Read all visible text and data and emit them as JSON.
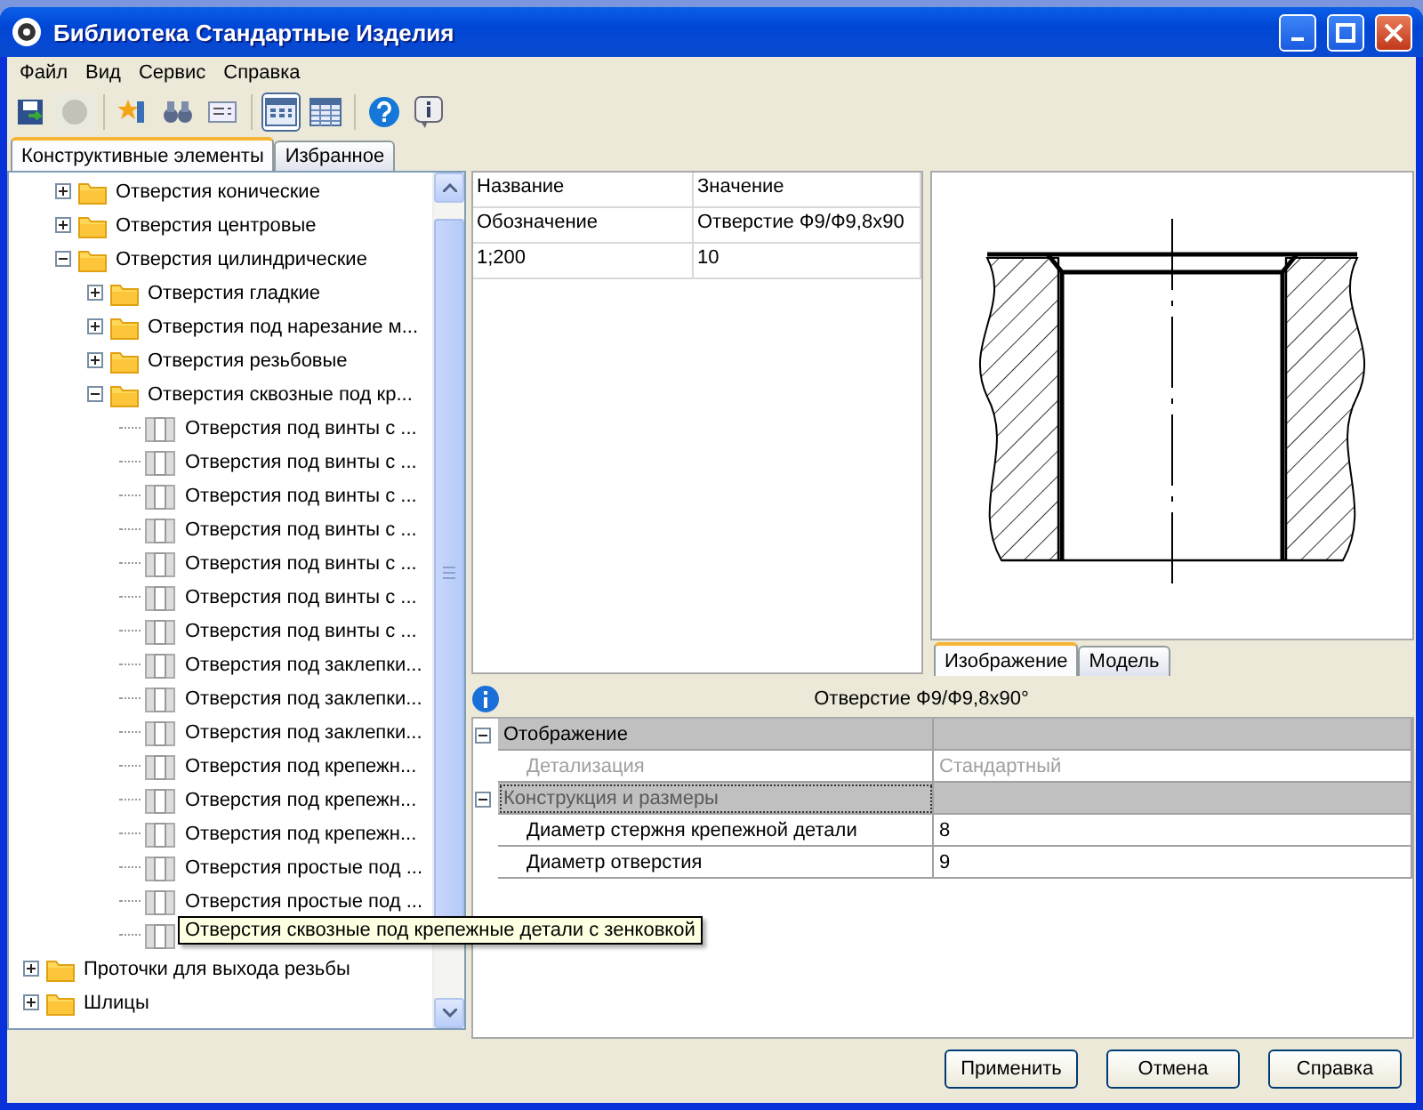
{
  "window": {
    "title": "Библиотека Стандартные Изделия"
  },
  "menu": [
    "Файл",
    "Вид",
    "Сервис",
    "Справка"
  ],
  "toolbar_groups": [
    [
      {
        "kind": "save",
        "disabled": false,
        "pressed": false
      },
      {
        "kind": "stop",
        "disabled": true,
        "pressed": false
      }
    ],
    [
      {
        "kind": "favorite",
        "disabled": false,
        "pressed": false
      },
      {
        "kind": "find",
        "disabled": false,
        "pressed": false
      },
      {
        "kind": "card",
        "disabled": false,
        "pressed": false
      }
    ],
    [
      {
        "kind": "grid",
        "disabled": false,
        "pressed": true
      },
      {
        "kind": "table",
        "disabled": false,
        "pressed": false
      }
    ],
    [
      {
        "kind": "help",
        "disabled": false,
        "pressed": false
      },
      {
        "kind": "info",
        "disabled": false,
        "pressed": false
      }
    ]
  ],
  "left_tabs": [
    {
      "label": "Конструктивные элементы",
      "selected": true
    },
    {
      "label": "Избранное",
      "selected": false
    }
  ],
  "tree": {
    "continued_children": [
      {
        "label": "Отверстия конические",
        "kind": "folder",
        "expanded": false
      },
      {
        "label": "Отверстия центровые",
        "kind": "folder",
        "expanded": false
      },
      {
        "label": "Отверстия цилиндрические",
        "kind": "folder",
        "expanded": true,
        "children": [
          {
            "label": "Отверстия гладкие",
            "kind": "folder",
            "expanded": false
          },
          {
            "label": "Отверстия под нарезание м...",
            "kind": "folder",
            "expanded": false
          },
          {
            "label": "Отверстия резьбовые",
            "kind": "folder",
            "expanded": false
          },
          {
            "label": "Отверстия сквозные под кр...",
            "kind": "folder",
            "expanded": true,
            "children": [
              {
                "label": "Отверстия под винты с ...",
                "kind": "part"
              },
              {
                "label": "Отверстия под винты с ...",
                "kind": "part"
              },
              {
                "label": "Отверстия под винты с ...",
                "kind": "part"
              },
              {
                "label": "Отверстия под винты с ...",
                "kind": "part"
              },
              {
                "label": "Отверстия под винты с ...",
                "kind": "part"
              },
              {
                "label": "Отверстия под винты с ...",
                "kind": "part"
              },
              {
                "label": "Отверстия под винты с ...",
                "kind": "part"
              },
              {
                "label": "Отверстия под заклепки...",
                "kind": "part"
              },
              {
                "label": "Отверстия под заклепки...",
                "kind": "part"
              },
              {
                "label": "Отверстия под заклепки...",
                "kind": "part"
              },
              {
                "label": "Отверстия под крепежн...",
                "kind": "part"
              },
              {
                "label": "Отверстия под крепежн...",
                "kind": "part"
              },
              {
                "label": "Отверстия под крепежн...",
                "kind": "part"
              },
              {
                "label": "Отверстия простые под ...",
                "kind": "part"
              },
              {
                "label": "Отверстия простые под ...",
                "kind": "part"
              },
              {
                "kind": "part"
              }
            ]
          }
        ]
      }
    ],
    "items": [
      {
        "label": "Проточки для выхода резьбы",
        "kind": "folder",
        "expanded": false
      },
      {
        "label": "Шлицы",
        "kind": "folder",
        "expanded": false
      }
    ],
    "tooltip": "Отверстия сквозные под крепежные  детали с зенковкой"
  },
  "table": {
    "columns": [
      "Название",
      "Значение"
    ],
    "rows": [
      [
        "Обозначение",
        "Отверстие Ф9/Ф9,8х90"
      ],
      [
        "1;200",
        "10"
      ]
    ]
  },
  "preview_tabs": [
    {
      "label": "Изображение",
      "selected": true
    },
    {
      "label": "Модель",
      "selected": false
    }
  ],
  "object_title": "Отверстие Ф9/Ф9,8х90°",
  "properties": [
    {
      "label": "Отображение",
      "expanded": true,
      "selected": false,
      "rows": [
        {
          "name": "Детализация",
          "value": "Стандартный",
          "disabled": true
        }
      ]
    },
    {
      "label": "Конструкция и размеры",
      "expanded": true,
      "selected": true,
      "rows": [
        {
          "name": "Диаметр стержня крепежной детали",
          "value": "8",
          "disabled": false
        },
        {
          "name": "Диаметр отверстия",
          "value": "9",
          "disabled": false
        }
      ]
    }
  ],
  "buttons": [
    "Применить",
    "Отмена",
    "Справка"
  ]
}
